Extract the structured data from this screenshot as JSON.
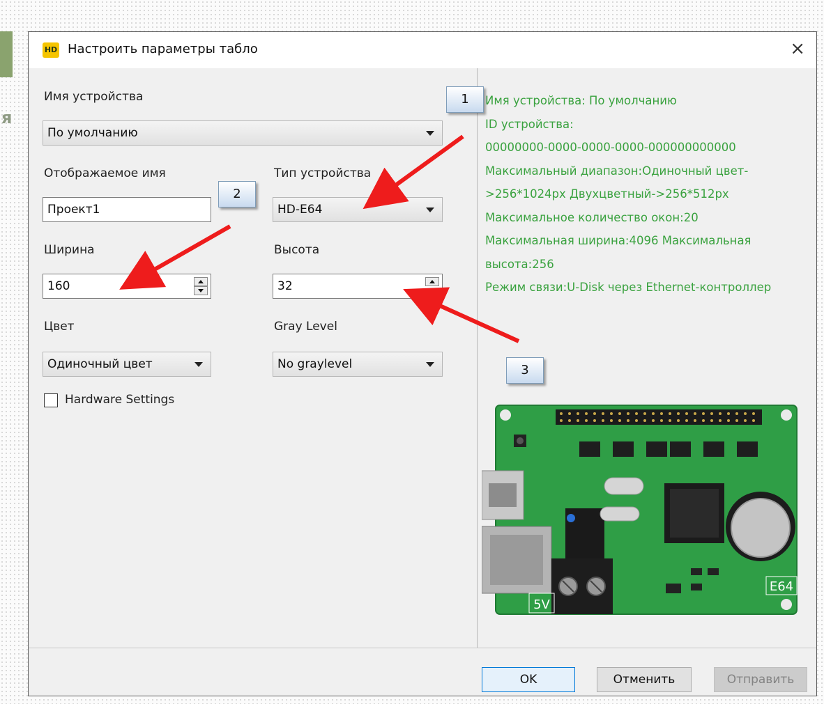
{
  "window": {
    "title": "Настроить параметры табло",
    "app_icon_text": "HD",
    "close_glyph": "×"
  },
  "background": {
    "letter": "я"
  },
  "form": {
    "device_name_label": "Имя устройства",
    "device_name_value": "По умолчанию",
    "display_name_label": "Отображаемое имя",
    "display_name_value": "Проект1",
    "device_type_label": "Тип устройства",
    "device_type_value": "HD-E64",
    "width_label": "Ширина",
    "width_value": "160",
    "height_label": "Высота",
    "height_value": "32",
    "color_label": "Цвет",
    "color_value": "Одиночный цвет",
    "gray_label": "Gray Level",
    "gray_value": "No graylevel",
    "hardware_label": "Hardware Settings",
    "hardware_checked": false
  },
  "info": [
    "Имя устройства: По умолчанию",
    "ID устройства:",
    "00000000-0000-0000-0000-000000000000",
    "Максимальный диапазон:Одиночный цвет-",
    ">256*1024px  Двухцветный->256*512px",
    "Максимальное количество окон:20",
    "Максимальная ширина:4096 Максимальная",
    "высота:256",
    "Режим связи:U-Disk  через Ethernet-контроллер"
  ],
  "board": {
    "label": "E64",
    "voltage": "5V"
  },
  "buttons": {
    "ok": "OK",
    "cancel": "Отменить",
    "send": "Отправить"
  },
  "callouts": {
    "one": "1",
    "two": "2",
    "three": "3"
  },
  "colors": {
    "info_text": "#3aa23f",
    "arrow": "#ee1c1c",
    "board_green": "#2f9e46",
    "send_disabled_text": "#838383"
  }
}
